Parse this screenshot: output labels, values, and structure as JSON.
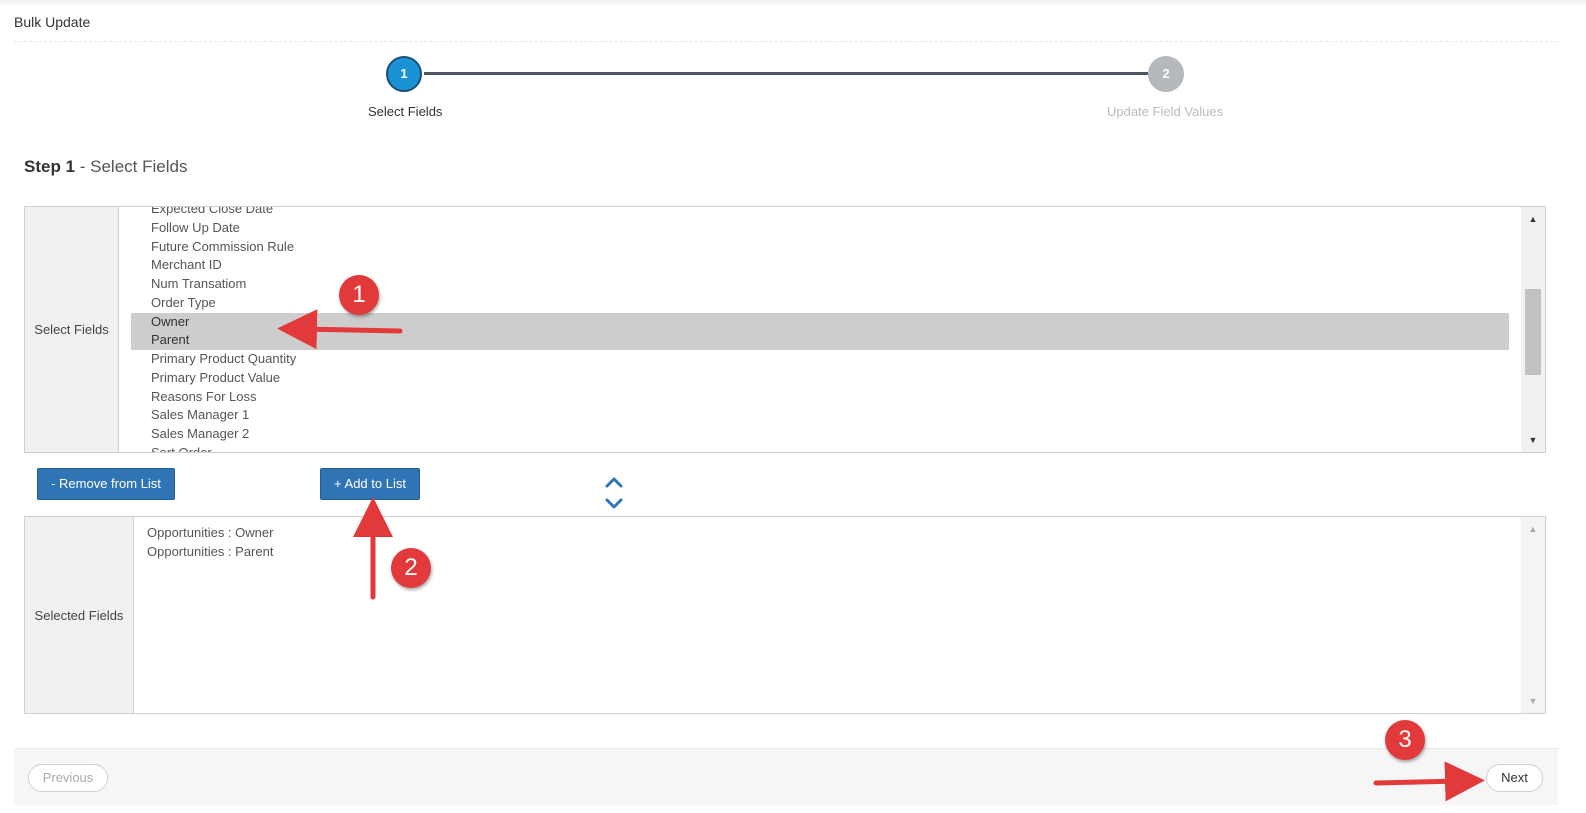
{
  "app": {
    "title": "Bulk Update"
  },
  "wizard": {
    "steps": [
      {
        "number": "1",
        "label": "Select Fields",
        "state": "active"
      },
      {
        "number": "2",
        "label": "Update Field Values",
        "state": "inactive"
      }
    ],
    "colors": {
      "active": "#1a92d6",
      "inactive": "#b5b8bc",
      "line": "#4a5566"
    }
  },
  "section": {
    "step_prefix": "Step 1",
    "title": " - Select Fields"
  },
  "select_fields": {
    "label": "Select Fields",
    "items": [
      {
        "label": "Expected Close Date",
        "selected": false
      },
      {
        "label": "Follow Up Date",
        "selected": false
      },
      {
        "label": "Future Commission Rule",
        "selected": false
      },
      {
        "label": "Merchant ID",
        "selected": false
      },
      {
        "label": "Num Transatiom",
        "selected": false
      },
      {
        "label": "Order Type",
        "selected": false
      },
      {
        "label": "Owner",
        "selected": true
      },
      {
        "label": "Parent",
        "selected": true
      },
      {
        "label": "Primary Product Quantity",
        "selected": false
      },
      {
        "label": "Primary Product Value",
        "selected": false
      },
      {
        "label": "Reasons For Loss",
        "selected": false
      },
      {
        "label": "Sales Manager 1",
        "selected": false
      },
      {
        "label": "Sales Manager 2",
        "selected": false
      },
      {
        "label": "Sort Order",
        "selected": false
      }
    ]
  },
  "buttons": {
    "remove": "- Remove from List",
    "add": "+ Add to List"
  },
  "order_controls": {
    "up_icon": "chevron-up-icon",
    "down_icon": "chevron-down-icon"
  },
  "selected_fields": {
    "label": "Selected Fields",
    "items": [
      "Opportunities : Owner",
      "Opportunities : Parent"
    ]
  },
  "footer": {
    "previous": "Previous",
    "next": "Next"
  },
  "annotations": {
    "badges": [
      "1",
      "2",
      "3"
    ],
    "color": "#e23a3a"
  }
}
